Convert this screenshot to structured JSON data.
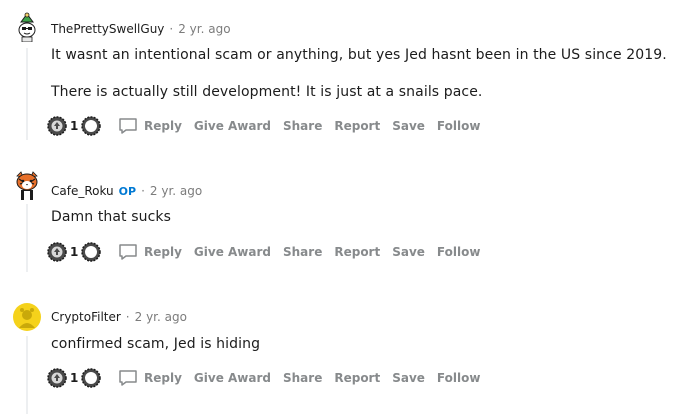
{
  "comments": [
    {
      "username": "ThePrettySwellGuy",
      "op_badge": "",
      "separator": "·",
      "time": "2 yr. ago",
      "paragraphs": [
        "It wasnt an intentional scam or anything, but yes Jed hasnt been in the US since 2019.",
        "There is actually still development! It is just at a snails pace."
      ],
      "vote_count": "1",
      "actions": {
        "reply": "Reply",
        "give_award": "Give Award",
        "share": "Share",
        "report": "Report",
        "save": "Save",
        "follow": "Follow"
      }
    },
    {
      "username": "Cafe_Roku",
      "op_badge": "OP",
      "separator": "·",
      "time": "2 yr. ago",
      "paragraphs": [
        "Damn that sucks"
      ],
      "vote_count": "1",
      "actions": {
        "reply": "Reply",
        "give_award": "Give Award",
        "share": "Share",
        "report": "Report",
        "save": "Save",
        "follow": "Follow"
      }
    },
    {
      "username": "CryptoFilter",
      "op_badge": "",
      "separator": "·",
      "time": "2 yr. ago",
      "paragraphs": [
        "confirmed scam, Jed is hiding"
      ],
      "vote_count": "1",
      "actions": {
        "reply": "Reply",
        "give_award": "Give Award",
        "share": "Share",
        "report": "Report",
        "save": "Save",
        "follow": "Follow"
      }
    }
  ],
  "icons": {
    "avatar_1": "snoo-avatar-icon",
    "avatar_2": "tiger-avatar-icon",
    "avatar_3": "default-yellow-avatar-icon",
    "upvote": "upvote-award-icon",
    "downvote": "downvote-award-icon",
    "reply": "comment-bubble-icon"
  },
  "colors": {
    "op_badge": "#0079d3",
    "action_text": "#878a8c",
    "meta_text": "#7c7c7c",
    "body_text": "#1c1c1c",
    "thread_line": "#edeff1"
  }
}
